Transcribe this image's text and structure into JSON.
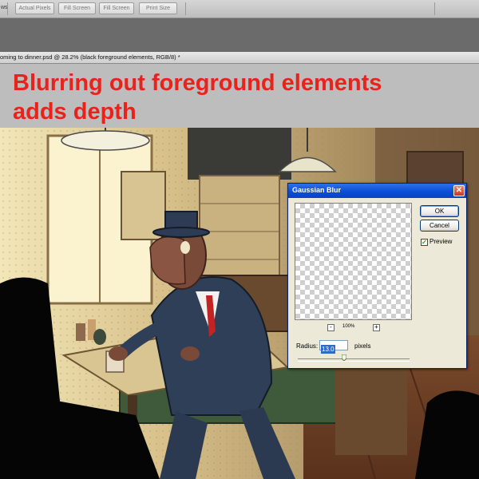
{
  "options_bar": {
    "tool_label_fragment": "ws",
    "buttons": [
      "Actual Pixels",
      "Fill Screen",
      "Fill Screen",
      "Print Size"
    ]
  },
  "document_tab": {
    "title": "oming to dinner.psd @ 28.2% (black foreground elements, RGB/8) *"
  },
  "caption": {
    "line1": "Blurring out foreground elements",
    "line2": "adds depth",
    "color": "#e8231c"
  },
  "dialog": {
    "title": "Gaussian Blur",
    "close_symbol": "✕",
    "ok_label": "OK",
    "cancel_label": "Cancel",
    "preview_label": "Preview",
    "preview_checked": true,
    "zoom_out_symbol": "-",
    "zoom_in_symbol": "+",
    "zoom_level": "100%",
    "radius_label": "Radius:",
    "radius_value": "13.0",
    "radius_unit": "pixels",
    "title_color": "#0b4fd8"
  },
  "icons": {
    "close": "close-icon",
    "checkbox": "checkmark-icon",
    "slider": "slider-thumb-icon"
  }
}
